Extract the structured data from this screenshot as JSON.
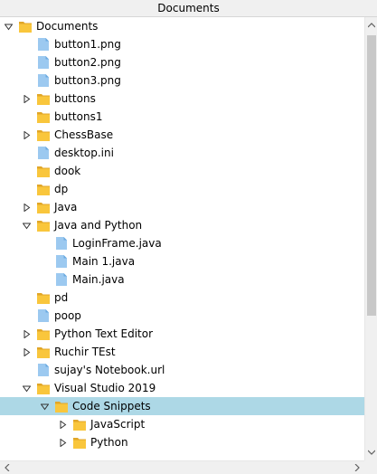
{
  "header": {
    "title": "Documents"
  },
  "colors": {
    "folder": "#f9c63c",
    "folder_dark": "#e1a628",
    "file": "#9cc9f0",
    "file_dark": "#6aa9df",
    "selected_row": "#add8e6"
  },
  "tree": [
    {
      "label": "Documents",
      "depth": 0,
      "icon": "folder-icon",
      "toggle": "expanded",
      "selected": false
    },
    {
      "label": "button1.png",
      "depth": 1,
      "icon": "file-icon",
      "toggle": "none",
      "selected": false
    },
    {
      "label": "button2.png",
      "depth": 1,
      "icon": "file-icon",
      "toggle": "none",
      "selected": false
    },
    {
      "label": "button3.png",
      "depth": 1,
      "icon": "file-icon",
      "toggle": "none",
      "selected": false
    },
    {
      "label": "buttons",
      "depth": 1,
      "icon": "folder-icon",
      "toggle": "collapsed",
      "selected": false
    },
    {
      "label": "buttons1",
      "depth": 1,
      "icon": "folder-icon",
      "toggle": "none",
      "selected": false
    },
    {
      "label": "ChessBase",
      "depth": 1,
      "icon": "folder-icon",
      "toggle": "collapsed",
      "selected": false
    },
    {
      "label": "desktop.ini",
      "depth": 1,
      "icon": "file-icon",
      "toggle": "none",
      "selected": false
    },
    {
      "label": "dook",
      "depth": 1,
      "icon": "folder-icon",
      "toggle": "none",
      "selected": false
    },
    {
      "label": "dp",
      "depth": 1,
      "icon": "folder-icon",
      "toggle": "none",
      "selected": false
    },
    {
      "label": "Java",
      "depth": 1,
      "icon": "folder-icon",
      "toggle": "collapsed",
      "selected": false
    },
    {
      "label": "Java and Python",
      "depth": 1,
      "icon": "folder-icon",
      "toggle": "expanded",
      "selected": false
    },
    {
      "label": "LoginFrame.java",
      "depth": 2,
      "icon": "file-icon",
      "toggle": "none",
      "selected": false
    },
    {
      "label": "Main 1.java",
      "depth": 2,
      "icon": "file-icon",
      "toggle": "none",
      "selected": false
    },
    {
      "label": "Main.java",
      "depth": 2,
      "icon": "file-icon",
      "toggle": "none",
      "selected": false
    },
    {
      "label": "pd",
      "depth": 1,
      "icon": "folder-icon",
      "toggle": "none",
      "selected": false
    },
    {
      "label": "poop",
      "depth": 1,
      "icon": "file-icon",
      "toggle": "none",
      "selected": false
    },
    {
      "label": "Python Text Editor",
      "depth": 1,
      "icon": "folder-icon",
      "toggle": "collapsed",
      "selected": false
    },
    {
      "label": "Ruchir TEst",
      "depth": 1,
      "icon": "folder-icon",
      "toggle": "collapsed",
      "selected": false
    },
    {
      "label": "sujay's Notebook.url",
      "depth": 1,
      "icon": "file-icon",
      "toggle": "none",
      "selected": false
    },
    {
      "label": "Visual Studio 2019",
      "depth": 1,
      "icon": "folder-icon",
      "toggle": "expanded",
      "selected": false
    },
    {
      "label": "Code Snippets",
      "depth": 2,
      "icon": "folder-icon",
      "toggle": "expanded",
      "selected": true
    },
    {
      "label": "JavaScript",
      "depth": 3,
      "icon": "folder-icon",
      "toggle": "collapsed",
      "selected": false
    },
    {
      "label": "Python",
      "depth": 3,
      "icon": "folder-icon",
      "toggle": "collapsed",
      "selected": false
    }
  ]
}
